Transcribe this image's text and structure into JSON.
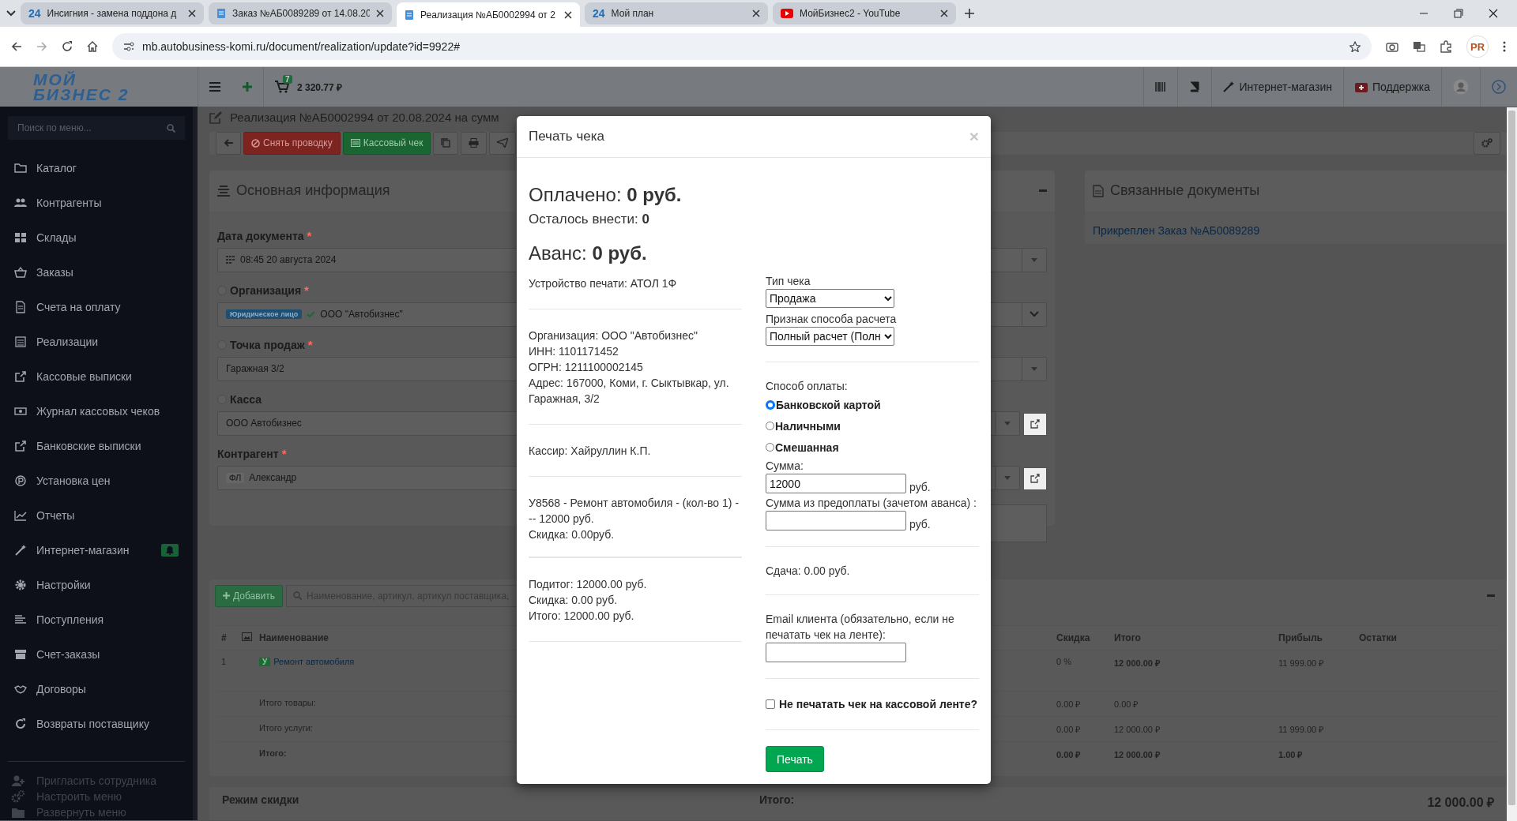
{
  "browser": {
    "tabs": [
      {
        "kind": "b24",
        "icon_text": "24",
        "title": "Инсигния - замена поддона д",
        "selected": false
      },
      {
        "kind": "doc",
        "title": "Заказ №АБ0089289 от 14.08.20",
        "selected": false
      },
      {
        "kind": "doc",
        "title": "Реализация №АБ0002994 от 2",
        "selected": true
      },
      {
        "kind": "b24",
        "icon_text": "24",
        "title": "Мой план",
        "selected": false
      },
      {
        "kind": "youtube",
        "title": "МойБизнес2 - YouTube",
        "selected": false
      }
    ],
    "url": "mb.autobusiness-komi.ru/document/realization/update?id=9922#",
    "profile": "PR"
  },
  "header": {
    "logo": "МОЙ\nБИЗНЕС 2",
    "cart_count": "7",
    "cart_total": "2 320.77 ₽",
    "links": [
      {
        "kind": "shop",
        "label": "Интернет-магазин"
      },
      {
        "kind": "support",
        "label": "Поддержка"
      }
    ]
  },
  "sidebar": {
    "search_placeholder": "Поиск по меню...",
    "items": [
      {
        "label": "Каталог",
        "alert": false
      },
      {
        "label": "Контрагенты",
        "alert": false
      },
      {
        "label": "Склады",
        "alert": false
      },
      {
        "label": "Заказы",
        "alert": false
      },
      {
        "label": "Счета на оплату",
        "alert": false
      },
      {
        "label": "Реализации",
        "alert": false
      },
      {
        "label": "Кассовые выписки",
        "alert": false
      },
      {
        "label": "Журнал кассовых чеков",
        "alert": false
      },
      {
        "label": "Банковские выписки",
        "alert": false
      },
      {
        "label": "Установка цен",
        "alert": false
      },
      {
        "label": "Отчеты",
        "alert": false
      },
      {
        "label": "Интернет-магазин",
        "alert": true
      },
      {
        "label": "Настройки",
        "alert": false
      },
      {
        "label": "Поступления",
        "alert": false
      },
      {
        "label": "Счет-заказы",
        "alert": false
      },
      {
        "label": "Договоры",
        "alert": false
      },
      {
        "label": "Возвраты поставщику",
        "alert": false
      }
    ],
    "footer": [
      "Пригласить сотрудника",
      "Настроить меню",
      "Развернуть меню"
    ]
  },
  "page": {
    "title": "Реализация №АБ0002994 от 20.08.2024 на сумм",
    "toolbar": {
      "unpost": "Снять проводку",
      "receipt": "Кассовый чек"
    }
  },
  "main_info": {
    "title": "Основная информация",
    "fields": [
      {
        "kind": "date",
        "label": "Дата документа",
        "required_mark": "*",
        "info_icon": false,
        "value": "08:45 20 августа 2024"
      },
      {
        "kind": "org",
        "label": "Организация",
        "required_mark": "*",
        "info_icon": true,
        "tag": "Юридическое лицо",
        "value": "ООО \"Автобизнес\""
      },
      {
        "kind": "select",
        "label": "Точка продаж",
        "required_mark": "*",
        "info_icon": true,
        "value": "Гаражная 3/2"
      },
      {
        "kind": "link-select",
        "label": "Касса",
        "info_icon": true,
        "value": "ООО Автобизнес"
      },
      {
        "kind": "person",
        "label": "Контрагент",
        "required_mark": "*",
        "info_icon": false,
        "tag": "ФЛ",
        "value": "Александр"
      }
    ]
  },
  "related": {
    "title": "Связанные документы",
    "link": "Прикреплен Заказ №АБ0089289"
  },
  "products": {
    "add": "Добавить",
    "search_placeholder": "Наименование, артикул, артикул поставщика,",
    "columns": {
      "num": "#",
      "name": "Наименование",
      "discount": "Скидка",
      "total": "Итого",
      "profit": "Прибыль",
      "stock": "Остатки"
    },
    "rows": [
      {
        "num": "1",
        "type_tag": "У",
        "name": "Ремонт автомобиля",
        "discount": "0 %",
        "total": "12 000.00 ₽",
        "profit": "11 999.00 ₽"
      }
    ],
    "totals": [
      {
        "label": "Итого товары:",
        "discount": "0.00 ₽",
        "total": "0.00 ₽",
        "bold": false
      },
      {
        "label": "Итого услуги:",
        "discount": "0.00 ₽",
        "total": "12 000.00 ₽",
        "profit": "11 999.00 ₽",
        "bold": false
      },
      {
        "label": "Итого:",
        "discount": "0.00 ₽",
        "total": "12 000.00 ₽",
        "profit": "1.00 ₽",
        "bold": true
      }
    ]
  },
  "summary": {
    "discount_mode": "Режим скидки",
    "total_label": "Итого:",
    "total": "12 000.00 ₽"
  },
  "modal": {
    "title": "Печать чека",
    "close": "×",
    "paid": "Оплачено: **0 руб.**",
    "remaining": "Осталось внести: **0**",
    "advance": "Аванс: **0 руб.**",
    "sections": [
      {
        "kind": "device",
        "lines": [
          "Устройство печати: АТОЛ 1Ф"
        ]
      },
      {
        "kind": "org",
        "lines": [
          "Организация: ООО \"Автобизнес\"",
          "ИНН: 1101171452",
          "ОГРН: 1211100002145",
          "Адрес: 167000, Коми, г. Сыктывкар, ул. Гаражная, 3/2"
        ]
      },
      {
        "kind": "cashier",
        "lines": [
          "Кассир: Хайруллин К.П."
        ]
      },
      {
        "kind": "items",
        "lines": [
          "У8568 - Ремонт автомобиля - (кол-во 1) --- 12000 руб.",
          "Скидка: 0.00руб."
        ]
      },
      {
        "kind": "totals",
        "lines": [
          "Подитог: 12000.00 руб.",
          "Скидка: 0.00 руб.",
          "Итого: 12000.00 руб."
        ]
      }
    ],
    "receipt_type": {
      "label": "Тип чека",
      "value": "Продажа"
    },
    "calc_method": {
      "label": "Признак способа расчета",
      "value": "Полный расчет (Полн"
    },
    "payment": {
      "label": "Способ оплаты:",
      "options": [
        {
          "label": "Банковской картой",
          "selected": true
        },
        {
          "label": "Наличными",
          "selected": false
        },
        {
          "label": "Смешанная",
          "selected": false
        }
      ]
    },
    "amount": {
      "label": "Сумма:",
      "value": "12000",
      "unit": "руб."
    },
    "prepaid": {
      "label": "Сумма из предоплаты (зачетом аванса) :",
      "unit": "руб."
    },
    "change": "Сдача: 0.00 руб.",
    "email": {
      "label": "Email клиента (обязательно, если не печатать чек на ленте):"
    },
    "no_print": {
      "label": "Не печатать чек на кассовой ленте?",
      "checked": false
    },
    "print_button": "Печать"
  }
}
